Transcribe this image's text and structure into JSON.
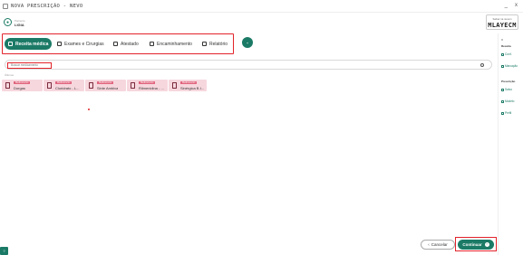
{
  "window": {
    "title": "NOVA PRESCRIÇÃO - NEVO",
    "controls": [
      "_",
      "x"
    ]
  },
  "patient": {
    "label": "Paciente",
    "name": "LIGIA"
  },
  "code": {
    "label": "Salvar na nuvem",
    "value": "MLAYECM"
  },
  "tabs": [
    {
      "label": "Receita médica",
      "icon": "pill-icon",
      "active": true
    },
    {
      "label": "Exames e Cirurgias",
      "icon": "link-icon",
      "active": false
    },
    {
      "label": "Atestado",
      "icon": "document-icon",
      "active": false
    },
    {
      "label": "Encaminhamento",
      "icon": "document-icon",
      "active": false
    },
    {
      "label": "Relatório",
      "icon": "document-icon",
      "active": false
    }
  ],
  "search": {
    "placeholder": "Buscar medicamento"
  },
  "recent": {
    "label": "Últimos",
    "cards": [
      {
        "badge": "Medicamento",
        "name": "Dorgas"
      },
      {
        "badge": "Medicamento",
        "name": "Cloridrato - L..."
      },
      {
        "badge": "Medicamento",
        "name": "Sinte Ambiva"
      },
      {
        "badge": "Medicamento",
        "name": "Rilmenidina - ..."
      },
      {
        "badge": "Medicamento",
        "name": "Sinérgica B.I..."
      }
    ]
  },
  "right_panel": {
    "close": "x",
    "section1": "Receita",
    "items1": [
      "Conf.",
      "Marcação"
    ],
    "section2": "Prescrição",
    "items2": [
      "Salvo",
      "Modelo",
      "Perfil"
    ]
  },
  "footer": {
    "cancel_label": "Cancelar",
    "continue_label": "Continuar"
  },
  "colors": {
    "accent": "#1b7a66",
    "highlight": "#e2232a",
    "card_bg": "#f7d7de"
  }
}
